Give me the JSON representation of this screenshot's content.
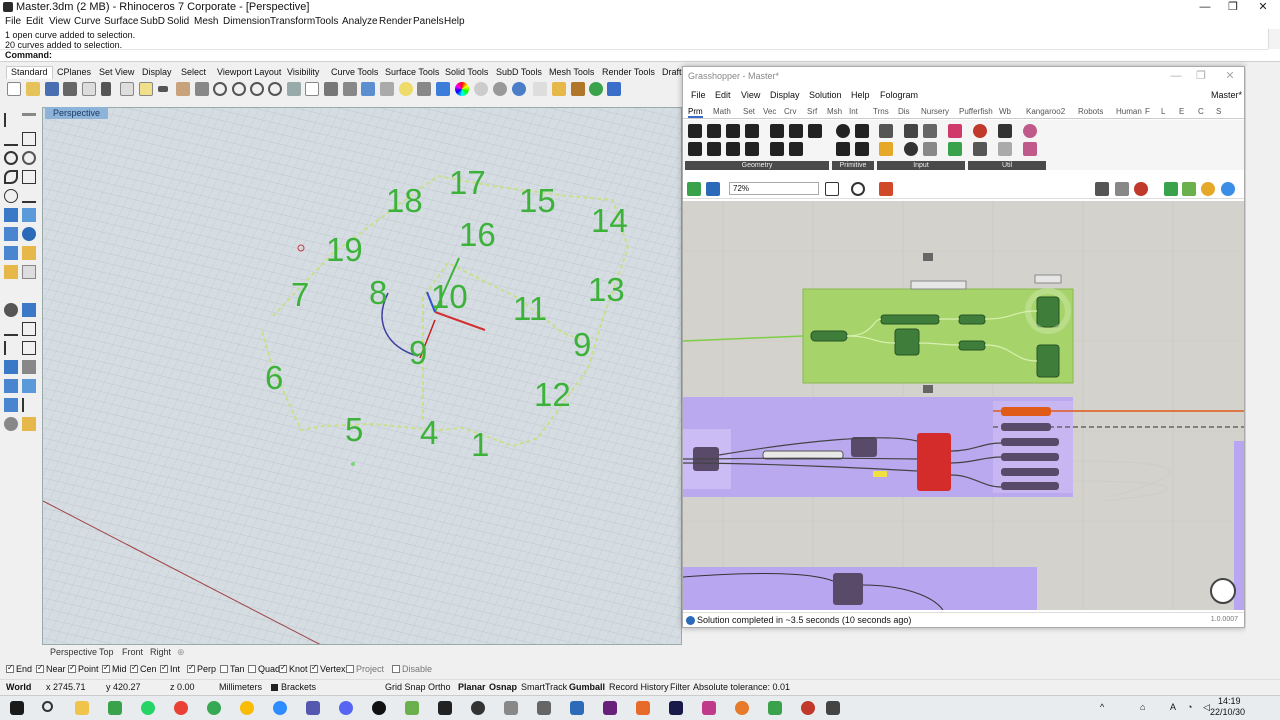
{
  "window": {
    "title": "Master.3dm (2 MB) - Rhinoceros 7 Corporate - [Perspective]",
    "minimize": "—",
    "maximize": "❐",
    "close": "✕"
  },
  "menu": [
    "File",
    "Edit",
    "View",
    "Curve",
    "Surface",
    "SubD",
    "Solid",
    "Mesh",
    "Dimension",
    "Transform",
    "Tools",
    "Analyze",
    "Render",
    "Panels",
    "Help"
  ],
  "command_history": [
    "1 open curve added to selection.",
    "20 curves added to selection."
  ],
  "command_prompt": "Command:",
  "toolbar_tabs": [
    "Standard",
    "CPlanes",
    "Set View",
    "Display",
    "Select",
    "Viewport Layout",
    "Visibility",
    "Curve Tools",
    "Surface Tools",
    "Solid Tools",
    "SubD Tools",
    "Mesh Tools",
    "Render Tools",
    "Drafti"
  ],
  "viewport": {
    "title": "Perspective",
    "labels": [
      "17",
      "18",
      "15",
      "14",
      "16",
      "19",
      "7",
      "8",
      "10",
      "11",
      "13",
      "9",
      "6",
      "5",
      "4",
      "1",
      "12"
    ]
  },
  "viewport_tabs": [
    "Perspective",
    "Top",
    "Front",
    "Right"
  ],
  "osnaps": [
    {
      "label": "End",
      "on": true
    },
    {
      "label": "Near",
      "on": true
    },
    {
      "label": "Point",
      "on": true
    },
    {
      "label": "Mid",
      "on": true
    },
    {
      "label": "Cen",
      "on": true
    },
    {
      "label": "Int",
      "on": true
    },
    {
      "label": "Perp",
      "on": true
    },
    {
      "label": "Tan",
      "on": false
    },
    {
      "label": "Quad",
      "on": false
    },
    {
      "label": "Knot",
      "on": true
    },
    {
      "label": "Vertex",
      "on": true
    },
    {
      "label": "Project",
      "on": false
    },
    {
      "label": "Disable",
      "on": false
    }
  ],
  "status": {
    "cplane": "World",
    "x": "x 2745.71",
    "y": "y 420.27",
    "z": "z 0.00",
    "units": "Millimeters",
    "layer": "Brackets",
    "grid_snap": "Grid Snap",
    "ortho": "Ortho",
    "planar": "Planar",
    "osnap": "Osnap",
    "smarttrack": "SmartTrack",
    "gumball": "Gumball",
    "record_history": "Record History",
    "filter": "Filter",
    "tolerance": "Absolute tolerance: 0.01"
  },
  "grasshopper": {
    "title": "Grasshopper - Master*",
    "menu": [
      "File",
      "Edit",
      "View",
      "Display",
      "Solution",
      "Help",
      "Fologram"
    ],
    "doc_name": "Master*",
    "tabs": [
      "Prm",
      "Math",
      "Set",
      "Vec",
      "Crv",
      "Srf",
      "Msh",
      "Int",
      "Trns",
      "Dis",
      "Nursery",
      "Pufferfish",
      "Wb",
      "Kangaroo2",
      "Robots",
      "Human",
      "F",
      "L",
      "E",
      "C",
      "S"
    ],
    "groups": [
      "Geometry",
      "Primitive",
      "Input",
      "Util"
    ],
    "zoom": "72%",
    "status_message": "Solution completed in ~3.5 seconds (10 seconds ago)",
    "version": "1.0.0007",
    "colors": {
      "green_group": "#a6d46a",
      "purple_group": "#b9a6f0"
    }
  },
  "taskbar": {
    "time": "14:19",
    "date": "22/10/30"
  }
}
